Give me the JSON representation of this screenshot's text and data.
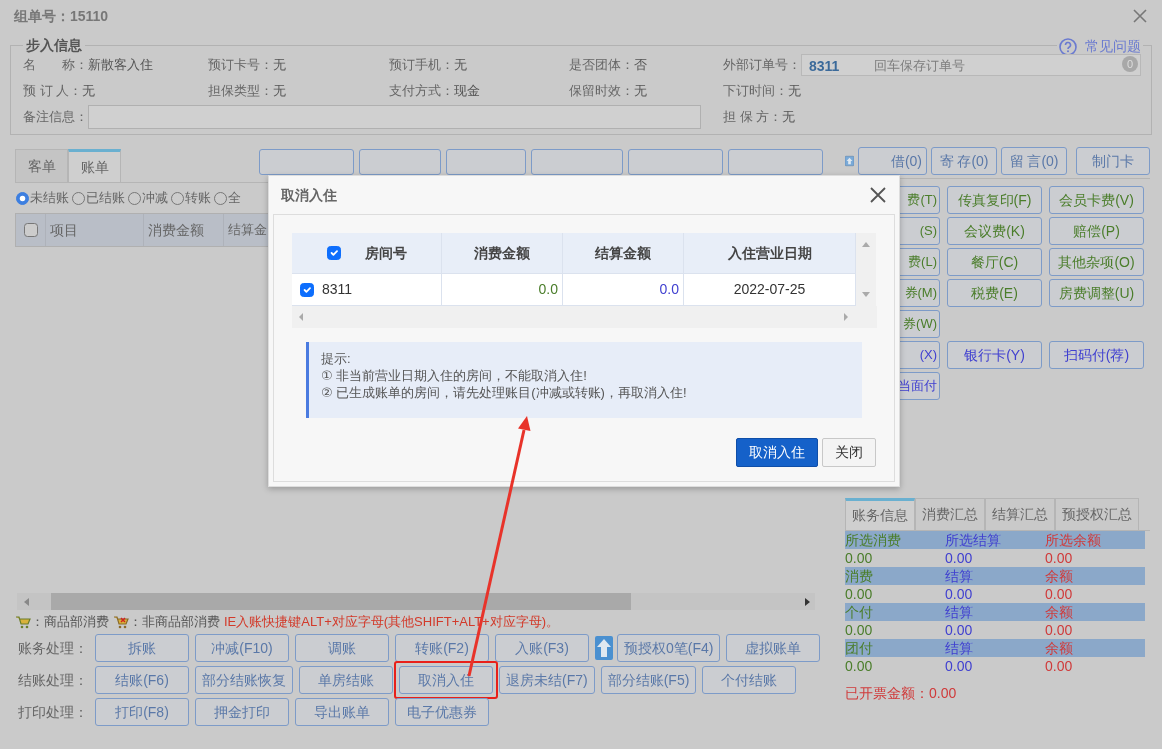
{
  "window": {
    "title": "组单号：15110"
  },
  "help_link": "常见问题",
  "info": {
    "legend": "步入信息",
    "fields": [
      {
        "label": "名　　称：",
        "value": "新散客入住"
      },
      {
        "label": "预订卡号：",
        "value": "无"
      },
      {
        "label": "预订手机：",
        "value": "无"
      },
      {
        "label": "是否团体：",
        "value": "否"
      },
      {
        "label": "预 订 人：",
        "value": "无"
      },
      {
        "label": "担保类型：",
        "value": "无"
      },
      {
        "label": "支付方式：",
        "value": "现金"
      },
      {
        "label": "保留时效：",
        "value": "无"
      }
    ],
    "external_order": {
      "label": "外部订单号：",
      "value": "8311",
      "placeholder": "回车保存订单号",
      "count": "0"
    },
    "order_time": {
      "label": "下订时间：",
      "value": "无"
    },
    "remark": {
      "label": "备注信息："
    },
    "guarantor": {
      "label": "担 保 方：",
      "value": "无"
    }
  },
  "tabs": [
    {
      "label": "客单",
      "selected": false
    },
    {
      "label": "账单",
      "selected": true
    }
  ],
  "filters": [
    {
      "label": "未结账",
      "selected": true
    },
    {
      "label": "已结账",
      "selected": false
    },
    {
      "label": "冲减",
      "selected": false
    },
    {
      "label": "转账",
      "selected": false
    },
    {
      "label": "全",
      "selected": false
    }
  ],
  "table": {
    "all_checked": false,
    "columns": [
      "项目",
      "消费金额",
      "结算金"
    ]
  },
  "legend": {
    "consume": "：商品部消费",
    "non_consume": "：非商品部消费",
    "hint": "IE入账快捷键ALT+对应字母(其他SHIFT+ALT+对应字母)。"
  },
  "action_rows": [
    {
      "label": "账务处理：",
      "buttons": [
        {
          "kind": "text",
          "label": "拆账",
          "highlighted": false
        },
        {
          "kind": "text",
          "label": "冲减(F10)",
          "highlighted": false
        },
        {
          "kind": "text",
          "label": "调账",
          "highlighted": false
        },
        {
          "kind": "text",
          "label": "转账(F2)",
          "highlighted": false
        },
        {
          "kind": "text",
          "label": "入账(F3)",
          "highlighted": false
        },
        {
          "kind": "icon"
        },
        {
          "kind": "text",
          "label": "预授权0笔(F4)",
          "highlighted": false
        },
        {
          "kind": "text",
          "label": "虚拟账单",
          "highlighted": false
        }
      ]
    },
    {
      "label": "结账处理：",
      "buttons": [
        {
          "kind": "text",
          "label": "结账(F6)",
          "highlighted": false
        },
        {
          "kind": "text",
          "label": "部分结账恢复",
          "highlighted": false
        },
        {
          "kind": "text",
          "label": "单房结账",
          "highlighted": false
        },
        {
          "kind": "text",
          "label": "取消入住",
          "highlighted": true
        },
        {
          "kind": "text",
          "label": "退房未结(F7)",
          "highlighted": false
        },
        {
          "kind": "text",
          "label": "部分结账(F5)",
          "highlighted": false
        },
        {
          "kind": "text",
          "label": "个付结账",
          "highlighted": false
        }
      ]
    },
    {
      "label": "打印处理：",
      "buttons": [
        {
          "kind": "text",
          "label": "打印(F8)",
          "highlighted": false
        },
        {
          "kind": "text",
          "label": "押金打印",
          "highlighted": false
        },
        {
          "kind": "text",
          "label": "导出账单",
          "highlighted": false
        },
        {
          "kind": "text",
          "label": "电子优惠券",
          "highlighted": false
        }
      ]
    }
  ],
  "right_top_buttons": [
    {
      "kind": "icon"
    },
    {
      "kind": "text",
      "label": "借(0)"
    },
    {
      "kind": "text",
      "label": "寄 存(0)"
    },
    {
      "kind": "text",
      "label": "留 言(0)"
    },
    {
      "kind": "text",
      "label": "制门卡"
    }
  ],
  "charge_rows": [
    [
      {
        "kind": "consume",
        "label": "费(T)"
      },
      {
        "kind": "consume",
        "label": "传真复印(F)"
      },
      {
        "kind": "consume",
        "label": "会员卡费(V)"
      }
    ],
    [
      {
        "kind": "consume",
        "label": "(S)"
      },
      {
        "kind": "consume",
        "label": "会议费(K)"
      },
      {
        "kind": "consume",
        "label": "赔偿(P)"
      }
    ],
    [
      {
        "kind": "consume",
        "label": "费(L)"
      },
      {
        "kind": "consume",
        "label": "餐厅(C)"
      },
      {
        "kind": "consume",
        "label": "其他杂项(O)"
      }
    ],
    [
      {
        "kind": "consume",
        "label": "券(M)"
      },
      {
        "kind": "consume",
        "label": "税费(E)"
      },
      {
        "kind": "consume",
        "label": "房费调整(U)"
      }
    ],
    [
      {
        "kind": "consume",
        "label": "券(W)"
      }
    ],
    [
      {
        "kind": "pay",
        "label": "(X)"
      },
      {
        "kind": "pay",
        "label": "银行卡(Y)"
      },
      {
        "kind": "pay",
        "label": "扫码付(荐)"
      }
    ],
    [
      {
        "kind": "pay",
        "label": "当面付"
      }
    ]
  ],
  "summary": {
    "tabs": [
      {
        "label": "账务信息",
        "selected": true
      },
      {
        "label": "消费汇总",
        "selected": false
      },
      {
        "label": "结算汇总",
        "selected": false
      },
      {
        "label": "预授权汇总",
        "selected": false
      }
    ],
    "groups": [
      {
        "labels": [
          "所选消费",
          "所选结算",
          "所选余额"
        ],
        "values": [
          "0.00",
          "0.00",
          "0.00"
        ]
      },
      {
        "labels": [
          "消费",
          "结算",
          "余额"
        ],
        "values": [
          "0.00",
          "0.00",
          "0.00"
        ]
      },
      {
        "labels": [
          "个付",
          "结算",
          "余额"
        ],
        "values": [
          "0.00",
          "0.00",
          "0.00"
        ]
      },
      {
        "labels": [
          "团付",
          "结算",
          "余额"
        ],
        "values": [
          "0.00",
          "0.00",
          "0.00"
        ]
      }
    ],
    "invoiced": "已开票金额：0.00"
  },
  "dialog": {
    "title": "取消入住",
    "all_checked": true,
    "columns": [
      "房间号",
      "消费金额",
      "结算金额",
      "入住营业日期"
    ],
    "rows": [
      {
        "checked": true,
        "room": "8311",
        "consumption": "0.0",
        "settlement": "0.0",
        "date": "2022-07-25"
      }
    ],
    "note_title": "提示:",
    "notes": [
      "① 非当前营业日期入住的房间，不能取消入住!",
      "② 已生成账单的房间，请先处理账目(冲减或转账)，再取消入住!"
    ],
    "buttons": [
      {
        "kind": "primary",
        "label": "取消入住"
      },
      {
        "kind": "secondary",
        "label": "关闭"
      }
    ]
  }
}
